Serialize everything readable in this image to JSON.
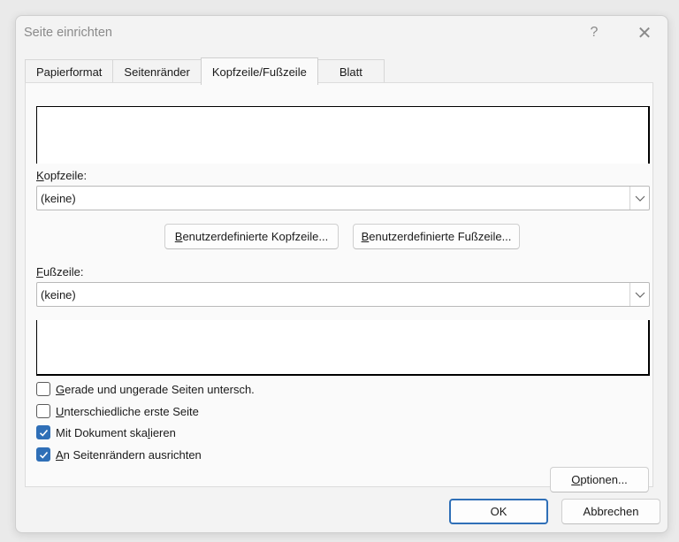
{
  "dialog": {
    "title": "Seite einrichten",
    "help_label": "?",
    "close_label": "✕"
  },
  "tabs": [
    {
      "label": "Papierformat",
      "active": false
    },
    {
      "label": "Seitenränder",
      "active": false
    },
    {
      "label": "Kopfzeile/Fußzeile",
      "active": true
    },
    {
      "label": "Blatt",
      "active": false
    }
  ],
  "header": {
    "label_key": "K",
    "label_rest": "opfzeile:",
    "value": "(keine)"
  },
  "custom_buttons": {
    "header_key": "B",
    "header_rest": "enutzerdefinierte Kopfzeile...",
    "footer_key": "B",
    "footer_rest": "enutzerdefinierte Fußzeile..."
  },
  "footer": {
    "label_key": "F",
    "label_rest": "ußzeile:",
    "value": "(keine)"
  },
  "options": [
    {
      "pre": "",
      "key": "G",
      "post": "erade und ungerade Seiten untersch.",
      "checked": false
    },
    {
      "pre": "",
      "key": "U",
      "post": "nterschiedliche erste Seite",
      "checked": false
    },
    {
      "pre": "Mit Dokument ska",
      "key": "l",
      "post": "ieren",
      "checked": true
    },
    {
      "pre": "",
      "key": "A",
      "post": "n Seitenrändern ausrichten",
      "checked": true
    }
  ],
  "options_button": {
    "key": "O",
    "rest": "ptionen..."
  },
  "footer_buttons": {
    "ok": "OK",
    "cancel": "Abbrechen"
  },
  "colors": {
    "accent": "#2f6fb7"
  }
}
